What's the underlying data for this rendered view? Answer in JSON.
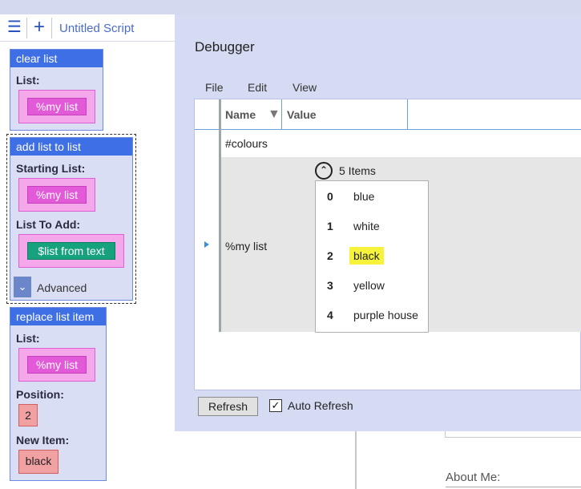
{
  "editor": {
    "menu_icon": "hamburger-menu-icon",
    "add_icon": "plus-icon",
    "script_title": "Untitled Script"
  },
  "blocks": {
    "clear_list": {
      "title": "clear list",
      "list_label": "List:",
      "list_value": "%my list"
    },
    "add_list_to_list": {
      "title": "add list to list",
      "starting_label": "Starting List:",
      "starting_value": "%my list",
      "to_add_label": "List To Add:",
      "to_add_value": "$list from text",
      "advanced_label": "Advanced"
    },
    "replace_list_item": {
      "title": "replace list item",
      "list_label": "List:",
      "list_value": "%my list",
      "position_label": "Position:",
      "position_value": "2",
      "new_item_label": "New Item:",
      "new_item_value": "black"
    }
  },
  "debugger": {
    "title": "Debugger",
    "menu": [
      "File",
      "Edit",
      "View"
    ],
    "columns": {
      "name": "Name",
      "value": "Value"
    },
    "rows": [
      {
        "name": "#colours",
        "value": ""
      },
      {
        "name": "%my list",
        "items_count": "5 Items",
        "items": [
          {
            "index": "0",
            "value": "blue"
          },
          {
            "index": "1",
            "value": "white"
          },
          {
            "index": "2",
            "value": "black"
          },
          {
            "index": "3",
            "value": "yellow"
          },
          {
            "index": "4",
            "value": "purple house"
          }
        ]
      }
    ],
    "refresh_label": "Refresh",
    "auto_refresh_label": "Auto Refresh",
    "auto_refresh_checked": true
  },
  "background": {
    "about_me": "About Me:"
  },
  "colors": {
    "block_header": "#3f6fe5",
    "variable_pill": "#e35ad9",
    "text_pill": "#17a27e",
    "highlight": "#f6f33a"
  }
}
